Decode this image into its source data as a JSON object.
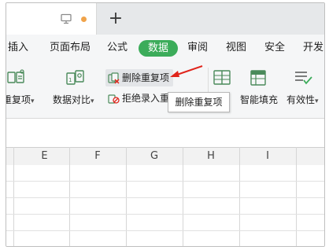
{
  "tabs": {
    "active_dot_color": "#f0a34a",
    "new_tab_label": "+"
  },
  "menu": {
    "items": [
      "插入",
      "页面布局",
      "公式",
      "数据",
      "审阅",
      "视图",
      "安全",
      "开发"
    ],
    "active_index": 3,
    "active_color": "#3cac5a"
  },
  "toolbar": {
    "remove_dup_partial": "重复项",
    "compare_label": "数据对比",
    "remove_dup_btn": "删除重复项",
    "reject_dup_btn": "拒绝录入重",
    "smart_fill_label": "智能填充",
    "validity_label": "有效性"
  },
  "tooltip": {
    "text": "删除重复项"
  },
  "grid": {
    "columns": [
      "E",
      "F",
      "G",
      "H",
      "I"
    ]
  },
  "annotation": {
    "arrow_color": "#e0241b"
  }
}
